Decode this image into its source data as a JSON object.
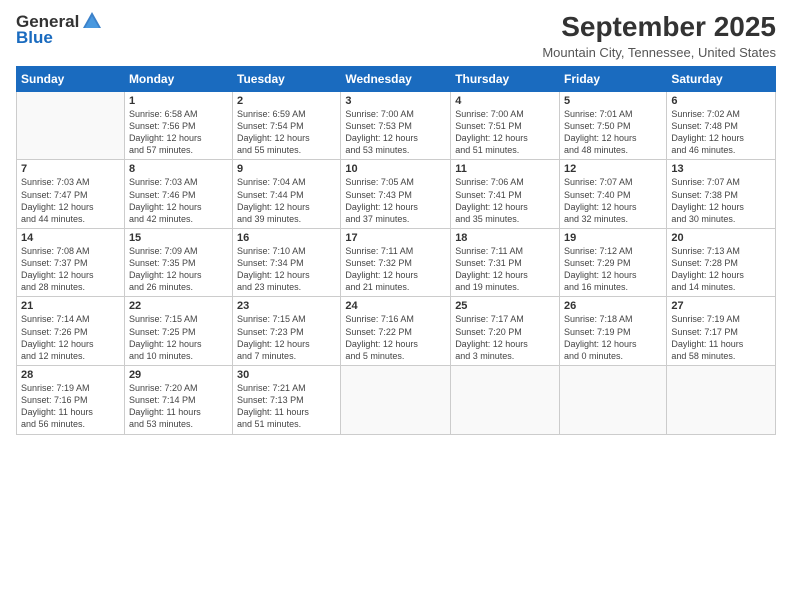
{
  "logo": {
    "general": "General",
    "blue": "Blue"
  },
  "header": {
    "month": "September 2025",
    "location": "Mountain City, Tennessee, United States"
  },
  "days_of_week": [
    "Sunday",
    "Monday",
    "Tuesday",
    "Wednesday",
    "Thursday",
    "Friday",
    "Saturday"
  ],
  "weeks": [
    [
      {
        "day": "",
        "info": ""
      },
      {
        "day": "1",
        "info": "Sunrise: 6:58 AM\nSunset: 7:56 PM\nDaylight: 12 hours\nand 57 minutes."
      },
      {
        "day": "2",
        "info": "Sunrise: 6:59 AM\nSunset: 7:54 PM\nDaylight: 12 hours\nand 55 minutes."
      },
      {
        "day": "3",
        "info": "Sunrise: 7:00 AM\nSunset: 7:53 PM\nDaylight: 12 hours\nand 53 minutes."
      },
      {
        "day": "4",
        "info": "Sunrise: 7:00 AM\nSunset: 7:51 PM\nDaylight: 12 hours\nand 51 minutes."
      },
      {
        "day": "5",
        "info": "Sunrise: 7:01 AM\nSunset: 7:50 PM\nDaylight: 12 hours\nand 48 minutes."
      },
      {
        "day": "6",
        "info": "Sunrise: 7:02 AM\nSunset: 7:48 PM\nDaylight: 12 hours\nand 46 minutes."
      }
    ],
    [
      {
        "day": "7",
        "info": "Sunrise: 7:03 AM\nSunset: 7:47 PM\nDaylight: 12 hours\nand 44 minutes."
      },
      {
        "day": "8",
        "info": "Sunrise: 7:03 AM\nSunset: 7:46 PM\nDaylight: 12 hours\nand 42 minutes."
      },
      {
        "day": "9",
        "info": "Sunrise: 7:04 AM\nSunset: 7:44 PM\nDaylight: 12 hours\nand 39 minutes."
      },
      {
        "day": "10",
        "info": "Sunrise: 7:05 AM\nSunset: 7:43 PM\nDaylight: 12 hours\nand 37 minutes."
      },
      {
        "day": "11",
        "info": "Sunrise: 7:06 AM\nSunset: 7:41 PM\nDaylight: 12 hours\nand 35 minutes."
      },
      {
        "day": "12",
        "info": "Sunrise: 7:07 AM\nSunset: 7:40 PM\nDaylight: 12 hours\nand 32 minutes."
      },
      {
        "day": "13",
        "info": "Sunrise: 7:07 AM\nSunset: 7:38 PM\nDaylight: 12 hours\nand 30 minutes."
      }
    ],
    [
      {
        "day": "14",
        "info": "Sunrise: 7:08 AM\nSunset: 7:37 PM\nDaylight: 12 hours\nand 28 minutes."
      },
      {
        "day": "15",
        "info": "Sunrise: 7:09 AM\nSunset: 7:35 PM\nDaylight: 12 hours\nand 26 minutes."
      },
      {
        "day": "16",
        "info": "Sunrise: 7:10 AM\nSunset: 7:34 PM\nDaylight: 12 hours\nand 23 minutes."
      },
      {
        "day": "17",
        "info": "Sunrise: 7:11 AM\nSunset: 7:32 PM\nDaylight: 12 hours\nand 21 minutes."
      },
      {
        "day": "18",
        "info": "Sunrise: 7:11 AM\nSunset: 7:31 PM\nDaylight: 12 hours\nand 19 minutes."
      },
      {
        "day": "19",
        "info": "Sunrise: 7:12 AM\nSunset: 7:29 PM\nDaylight: 12 hours\nand 16 minutes."
      },
      {
        "day": "20",
        "info": "Sunrise: 7:13 AM\nSunset: 7:28 PM\nDaylight: 12 hours\nand 14 minutes."
      }
    ],
    [
      {
        "day": "21",
        "info": "Sunrise: 7:14 AM\nSunset: 7:26 PM\nDaylight: 12 hours\nand 12 minutes."
      },
      {
        "day": "22",
        "info": "Sunrise: 7:15 AM\nSunset: 7:25 PM\nDaylight: 12 hours\nand 10 minutes."
      },
      {
        "day": "23",
        "info": "Sunrise: 7:15 AM\nSunset: 7:23 PM\nDaylight: 12 hours\nand 7 minutes."
      },
      {
        "day": "24",
        "info": "Sunrise: 7:16 AM\nSunset: 7:22 PM\nDaylight: 12 hours\nand 5 minutes."
      },
      {
        "day": "25",
        "info": "Sunrise: 7:17 AM\nSunset: 7:20 PM\nDaylight: 12 hours\nand 3 minutes."
      },
      {
        "day": "26",
        "info": "Sunrise: 7:18 AM\nSunset: 7:19 PM\nDaylight: 12 hours\nand 0 minutes."
      },
      {
        "day": "27",
        "info": "Sunrise: 7:19 AM\nSunset: 7:17 PM\nDaylight: 11 hours\nand 58 minutes."
      }
    ],
    [
      {
        "day": "28",
        "info": "Sunrise: 7:19 AM\nSunset: 7:16 PM\nDaylight: 11 hours\nand 56 minutes."
      },
      {
        "day": "29",
        "info": "Sunrise: 7:20 AM\nSunset: 7:14 PM\nDaylight: 11 hours\nand 53 minutes."
      },
      {
        "day": "30",
        "info": "Sunrise: 7:21 AM\nSunset: 7:13 PM\nDaylight: 11 hours\nand 51 minutes."
      },
      {
        "day": "",
        "info": ""
      },
      {
        "day": "",
        "info": ""
      },
      {
        "day": "",
        "info": ""
      },
      {
        "day": "",
        "info": ""
      }
    ]
  ]
}
